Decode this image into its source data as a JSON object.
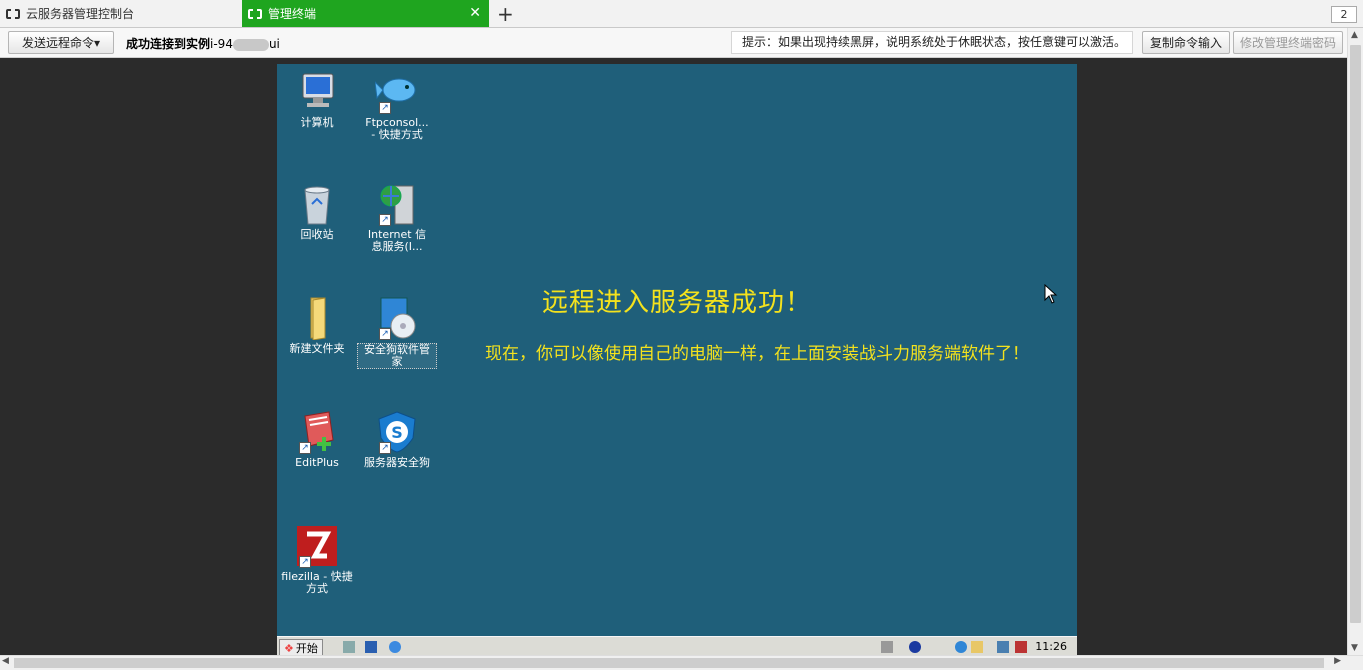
{
  "tabs": [
    {
      "label": "云服务器管理控制台"
    },
    {
      "label": "管理终端"
    }
  ],
  "tab_count": "2",
  "toolbar": {
    "send_label": "发送远程命令▾",
    "connected_label": "成功连接到实例",
    "instance_prefix": "i-94",
    "instance_suffix": "ui",
    "tip": "提示：如果出现持续黑屏，说明系统处于休眠状态，按任意键可以激活。",
    "copy_label": "复制命令输入",
    "change_label": "修改管理终端密码"
  },
  "desktop": {
    "icons": [
      {
        "label": "计算机",
        "icon": "computer-icon"
      },
      {
        "label": "Ftpconsol...\n- 快捷方式",
        "icon": "fish-icon"
      },
      {
        "label": "回收站",
        "icon": "recycle-bin-icon"
      },
      {
        "label": "Internet 信\n息服务(I...",
        "icon": "iis-icon"
      },
      {
        "label": "新建文件夹",
        "icon": "folder-icon"
      },
      {
        "label": "安全狗软件管\n家",
        "icon": "cd-icon"
      },
      {
        "label": "EditPlus",
        "icon": "editplus-icon"
      },
      {
        "label": "服务器安全狗",
        "icon": "shield-icon"
      },
      {
        "label": "filezilla -\n快捷方式",
        "icon": "filezilla-icon"
      }
    ],
    "message_title": "远程进入服务器成功！",
    "message_body": "现在，你可以像使用自己的电脑一样，在上面安装战斗力服务端软件了！",
    "background": "#1f5f7a",
    "text_color": "#f4e21d"
  },
  "taskbar": {
    "start_label": "开始",
    "clock": "11:26"
  },
  "colors": {
    "active_tab": "#1fa51f"
  }
}
